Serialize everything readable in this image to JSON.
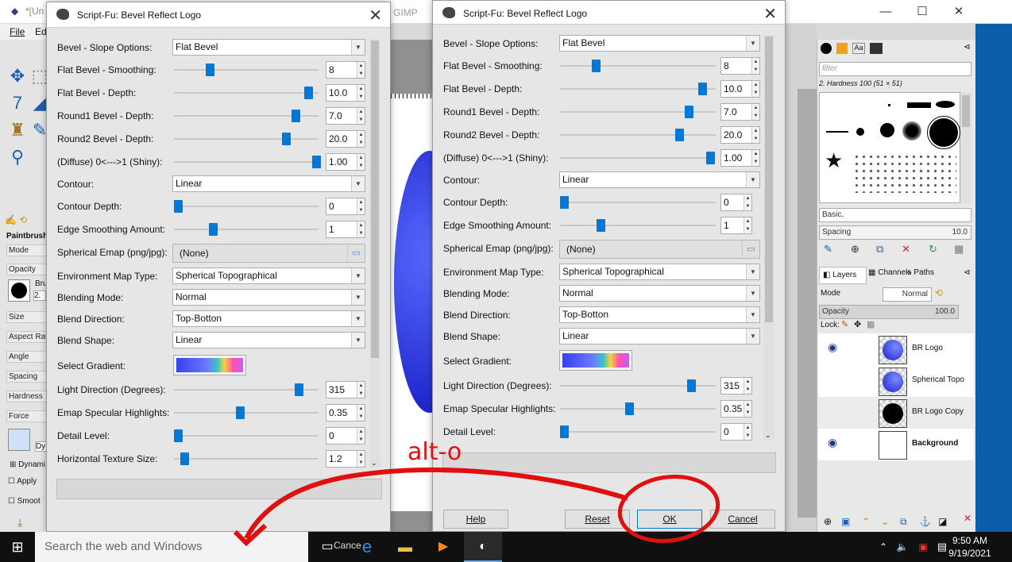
{
  "background_window": {
    "title_fragment": "*[Un",
    "title_fragment_right": "GIMP",
    "menu": [
      "File",
      "Ed"
    ],
    "tool_options": {
      "tool": "Paintbrush",
      "mode": "Mode",
      "opacity": "Opacity",
      "brush": "Bru",
      "brush_size_val": "2.",
      "size": "Size",
      "aspect_ratio": "Aspect Rati",
      "angle": "Angle",
      "spacing": "Spacing",
      "hardness": "Hardness",
      "force": "Force",
      "dynamics_value": "Dy",
      "dynamics_opts": "Dynami",
      "apply": "Apply",
      "smooth": "Smoot"
    }
  },
  "dock": {
    "filter_placeholder": "filter",
    "brush_name": "2. Hardness 100 (51 × 51)",
    "brush_set": "Basic,",
    "spacing_label": "Spacing",
    "spacing_value": "10.0",
    "tabs": [
      "Layers",
      "Channels",
      "Paths"
    ],
    "mode_label": "Mode",
    "mode_value": "Normal",
    "opacity_label": "Opacity",
    "opacity_value": "100.0",
    "lock_label": "Lock:",
    "layers": [
      {
        "name": "BR Logo",
        "visible": true
      },
      {
        "name": "Spherical Topo",
        "visible": false
      },
      {
        "name": "BR Logo Copy",
        "visible": false
      },
      {
        "name": "Background",
        "visible": true
      }
    ]
  },
  "dialog_left": {
    "title": "Script-Fu: Bevel Reflect Logo",
    "fields": {
      "bevel_slope": {
        "label": "Bevel - Slope Options:",
        "value": "Flat Bevel"
      },
      "flat_smoothing": {
        "label": "Flat Bevel - Smoothing:",
        "value": "8"
      },
      "flat_depth": {
        "label": "Flat Bevel - Depth:",
        "value": "10.0"
      },
      "round1_depth": {
        "label": "Round1 Bevel - Depth:",
        "value": "7.0"
      },
      "round2_depth": {
        "label": "Round2 Bevel - Depth:",
        "value": "20.0"
      },
      "diffuse_shiny": {
        "label": "(Diffuse) 0<--->1 (Shiny):",
        "value": "1.00"
      },
      "contour": {
        "label": "Contour:",
        "value": "Linear"
      },
      "contour_depth": {
        "label": "Contour Depth:",
        "value": "0"
      },
      "edge_smoothing": {
        "label": "Edge Smoothing Amount:",
        "value": "1"
      },
      "spherical_emap": {
        "label": "Spherical Emap (png/jpg):",
        "value": "(None)"
      },
      "env_map_type": {
        "label": "Environment Map Type:",
        "value": "Spherical Topographical"
      },
      "blending_mode": {
        "label": "Blending Mode:",
        "value": "Normal"
      },
      "blend_direction": {
        "label": "Blend Direction:",
        "value": "Top-Botton"
      },
      "blend_shape": {
        "label": "Blend Shape:",
        "value": "Linear"
      },
      "select_gradient": {
        "label": "Select Gradient:"
      },
      "light_direction": {
        "label": "Light Direction (Degrees):",
        "value": "315"
      },
      "emap_specular": {
        "label": "Emap Specular Highlights:",
        "value": "0.35"
      },
      "detail_level": {
        "label": "Detail Level:",
        "value": "0"
      },
      "h_texture_size": {
        "label": "Horizontal Texture Size:",
        "value": "1.2"
      }
    }
  },
  "dialog_right": {
    "title": "Script-Fu: Bevel Reflect Logo",
    "fields": {
      "bevel_slope": {
        "label": "Bevel - Slope Options:",
        "value": "Flat Bevel"
      },
      "flat_smoothing": {
        "label": "Flat Bevel - Smoothing:",
        "value": "8"
      },
      "flat_depth": {
        "label": "Flat Bevel - Depth:",
        "value": "10.0"
      },
      "round1_depth": {
        "label": "Round1 Bevel - Depth:",
        "value": "7.0"
      },
      "round2_depth": {
        "label": "Round2 Bevel - Depth:",
        "value": "20.0"
      },
      "diffuse_shiny": {
        "label": "(Diffuse) 0<--->1 (Shiny):",
        "value": "1.00"
      },
      "contour": {
        "label": "Contour:",
        "value": "Linear"
      },
      "contour_depth": {
        "label": "Contour Depth:",
        "value": "0"
      },
      "edge_smoothing": {
        "label": "Edge Smoothing Amount:",
        "value": "1"
      },
      "spherical_emap": {
        "label": "Spherical Emap (png/jpg):",
        "value": "(None)"
      },
      "env_map_type": {
        "label": "Environment Map Type:",
        "value": "Spherical Topographical"
      },
      "blending_mode": {
        "label": "Blending Mode:",
        "value": "Normal"
      },
      "blend_direction": {
        "label": "Blend Direction:",
        "value": "Top-Botton"
      },
      "blend_shape": {
        "label": "Blend Shape:",
        "value": "Linear"
      },
      "select_gradient": {
        "label": "Select Gradient:"
      },
      "light_direction": {
        "label": "Light Direction (Degrees):",
        "value": "315"
      },
      "emap_specular": {
        "label": "Emap Specular Highlights:",
        "value": "0.35"
      },
      "detail_level": {
        "label": "Detail Level:",
        "value": "0"
      }
    },
    "buttons": {
      "help": "Help",
      "reset": "Reset",
      "ok": "OK",
      "cancel": "Cancel"
    }
  },
  "taskbar": {
    "search_placeholder": "Search the web and Windows",
    "time": "9:50 AM",
    "date": "9/19/2021",
    "hidden_label": "Cance"
  },
  "annotation": {
    "text": "alt-o",
    "color": "#e01010"
  },
  "colors": {
    "accent": "#0078d7",
    "annotation_red": "#e01010",
    "taskbar": "#101010"
  }
}
